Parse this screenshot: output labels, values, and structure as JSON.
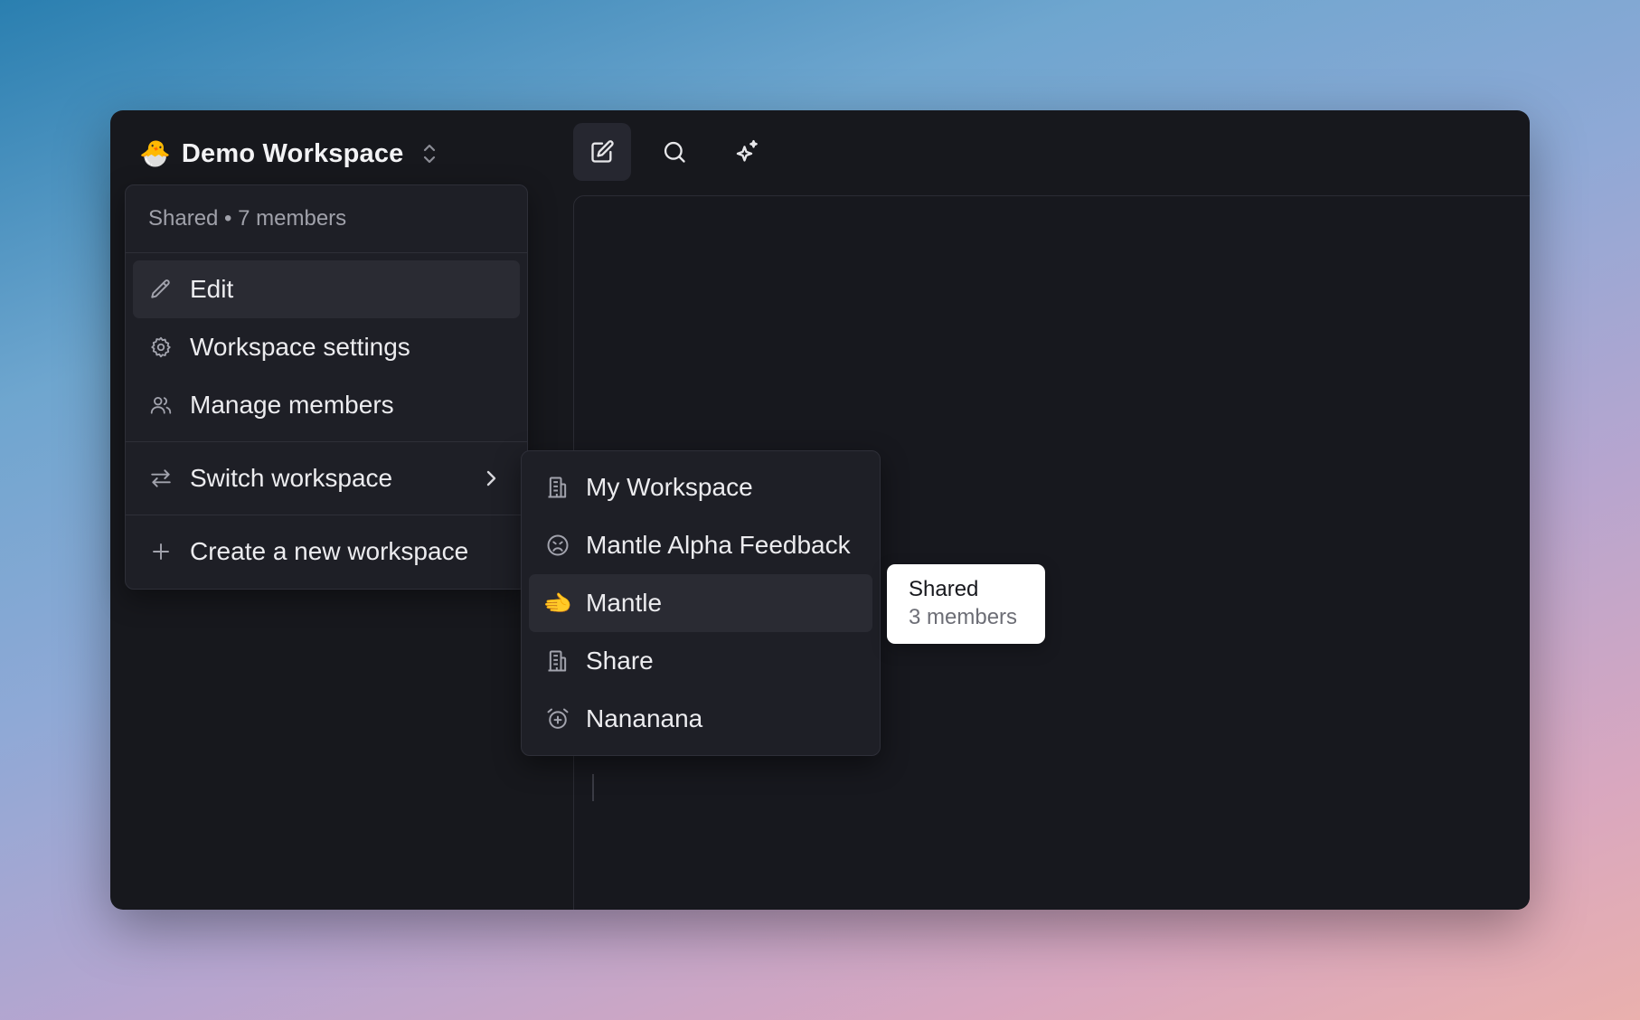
{
  "workspace": {
    "emoji": "🐣",
    "name": "Demo Workspace"
  },
  "toolbar": {
    "icons": [
      "edit-icon",
      "search-icon",
      "sparkles-icon"
    ]
  },
  "menu": {
    "header": "Shared • 7 members",
    "items": {
      "edit": "Edit",
      "settings": "Workspace settings",
      "members": "Manage members",
      "switch": "Switch workspace",
      "create": "Create a new workspace"
    }
  },
  "submenu": {
    "items": [
      {
        "label": "My Workspace",
        "icon": "building-icon"
      },
      {
        "label": "Mantle Alpha Feedback",
        "icon": "frown-icon"
      },
      {
        "label": "Mantle",
        "icon": "🫲"
      },
      {
        "label": "Share",
        "icon": "building-icon"
      },
      {
        "label": "Nananana",
        "icon": "alarm-plus-icon"
      }
    ]
  },
  "tooltip": {
    "line1": "Shared",
    "line2": "3 members"
  },
  "colors": {
    "window_bg": "#17181d",
    "menu_bg": "#1e1f26",
    "highlight": "#2a2b33"
  }
}
